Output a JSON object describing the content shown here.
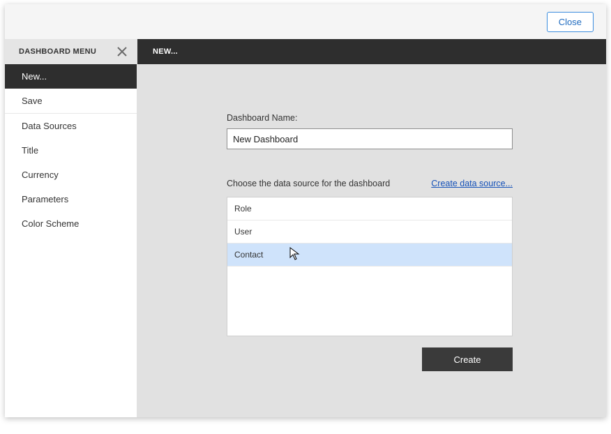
{
  "topbar": {
    "close_label": "Close"
  },
  "sidebar": {
    "title": "DASHBOARD MENU",
    "items": [
      {
        "label": "New...",
        "active": true
      },
      {
        "label": "Save"
      },
      {
        "label": "Data Sources"
      },
      {
        "label": "Title"
      },
      {
        "label": "Currency"
      },
      {
        "label": "Parameters"
      },
      {
        "label": "Color Scheme"
      }
    ]
  },
  "main": {
    "header": "NEW...",
    "name_label": "Dashboard Name:",
    "name_value": "New Dashboard",
    "ds_prompt": "Choose the data source for the dashboard",
    "create_ds_link": "Create data source...",
    "data_sources": [
      {
        "label": "Role"
      },
      {
        "label": "User"
      },
      {
        "label": "Contact",
        "selected": true
      }
    ],
    "create_label": "Create"
  }
}
